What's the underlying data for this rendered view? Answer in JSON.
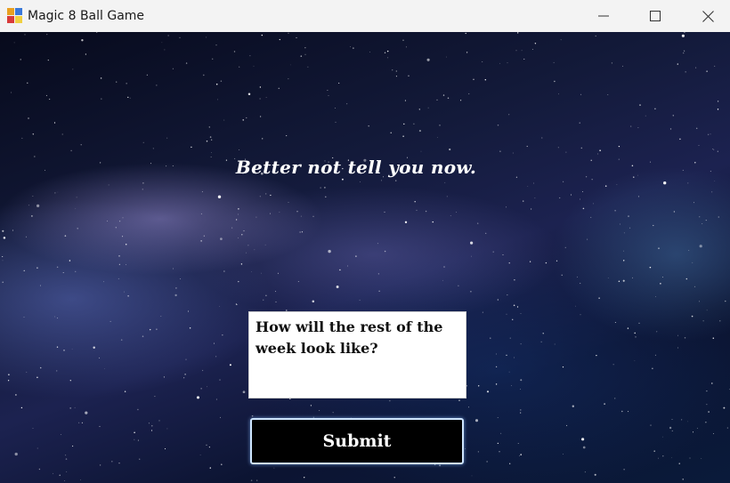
{
  "window": {
    "title": "Magic 8 Ball Game",
    "icon": "app-icon-colored-squares",
    "controls": [
      "minimize-icon",
      "maximize-icon",
      "close-icon"
    ]
  },
  "main": {
    "answer_text": "Better not tell you now.",
    "question_value": "How will the rest of the week look like?",
    "submit_label": "Submit",
    "background": "starry-night-sky"
  },
  "colors": {
    "titlebar": "#f3f3f3",
    "submit_bg": "#000000",
    "submit_border": "#cfe6ff",
    "text_light": "#ffffff"
  }
}
